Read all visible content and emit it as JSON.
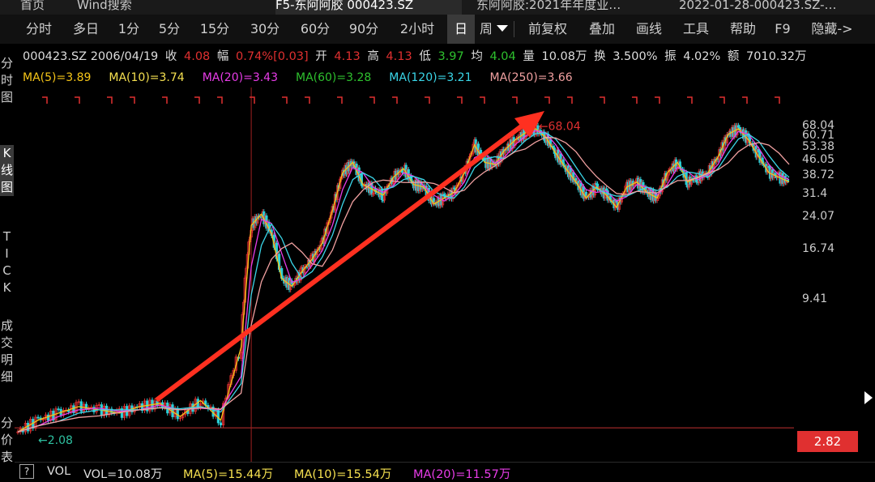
{
  "top_tabs": [
    {
      "label": "首页",
      "active": false
    },
    {
      "label": "Wind搜索",
      "active": false
    },
    {
      "label": "F5-东阿阿胶 000423.SZ",
      "active": true
    },
    {
      "label": "东阿阿胶:2021年年度业…",
      "active": false
    },
    {
      "label": "2022-01-28-000423.SZ-…",
      "active": false
    }
  ],
  "periods": [
    "分时",
    "多日",
    "1分",
    "5分",
    "15分",
    "30分",
    "60分",
    "90分",
    "2小时",
    "日",
    "周"
  ],
  "active_period": "日",
  "tools": [
    "前复权",
    "叠加",
    "画线",
    "工具",
    "帮助",
    "F9",
    "隐藏->"
  ],
  "left_rail": [
    {
      "label": "分时图",
      "active": false
    },
    {
      "label": "K线图",
      "active": true
    },
    {
      "label": "TICK",
      "active": false
    },
    {
      "label": "成交明细",
      "active": false
    },
    {
      "label": "分价表",
      "active": false
    }
  ],
  "quote": {
    "code_date": "000423.SZ 2006/04/19",
    "close_label": "收",
    "close": "4.08",
    "amp_label": "幅",
    "amp": "0.74%[0.03]",
    "open_label": "开",
    "open": "4.13",
    "high_label": "高",
    "high": "4.13",
    "low_label": "低",
    "low": "3.97",
    "avg_label": "均",
    "avg": "4.04",
    "vol_label": "量",
    "vol": "10.08万",
    "turn_label": "换",
    "turn": "3.500%",
    "swing_label": "振",
    "swing": "4.02%",
    "amount_label": "额",
    "amount": "7010.32万"
  },
  "ma_labels": [
    {
      "text": "MA(5)=3.89",
      "color": "#f5c518"
    },
    {
      "text": "MA(10)=3.74",
      "color": "#f5e050"
    },
    {
      "text": "MA(20)=3.43",
      "color": "#e83ce8"
    },
    {
      "text": "MA(60)=3.28",
      "color": "#2ec02e"
    },
    {
      "text": "MA(120)=3.21",
      "color": "#3ad6e8"
    },
    {
      "text": "MA(250)=3.66",
      "color": "#f0a0a0"
    }
  ],
  "volume": {
    "help": "?",
    "title": "VOL",
    "items": [
      {
        "text": "VOL=10.08万",
        "color": "#dddddd"
      },
      {
        "text": "MA(5)=15.44万",
        "color": "#f5e050"
      },
      {
        "text": "MA(10)=15.54万",
        "color": "#f5e050"
      },
      {
        "text": "MA(20)=11.57万",
        "color": "#e83ce8"
      }
    ]
  },
  "chart_data": {
    "type": "candlestick",
    "scale": "log",
    "y_ticks": [
      68.04,
      60.71,
      53.38,
      46.05,
      38.72,
      31.4,
      24.07,
      16.74,
      9.41
    ],
    "ylim": [
      1.9,
      80
    ],
    "high_annotation": "68.04",
    "low_annotation": "2.08",
    "last_price": "2.82",
    "trend_arrow": true,
    "x": [
      0,
      10,
      20,
      30,
      40,
      50,
      60,
      70,
      80,
      90,
      100,
      110,
      115,
      120,
      125,
      130,
      135,
      140,
      145,
      150,
      155,
      160,
      165,
      170,
      175,
      180,
      185,
      190,
      195,
      200,
      205,
      210,
      215,
      220,
      225,
      230,
      235,
      240,
      245,
      250,
      255,
      260,
      265,
      270,
      275,
      280,
      285,
      290,
      295,
      300,
      305,
      310,
      315,
      320,
      325,
      330,
      335,
      340,
      345,
      350,
      355,
      360,
      365,
      370,
      375,
      380
    ],
    "close": [
      2.1,
      2.4,
      2.6,
      2.8,
      2.7,
      2.6,
      2.8,
      2.9,
      2.5,
      3.0,
      2.4,
      5.5,
      22,
      25,
      20,
      12,
      11,
      13,
      15,
      18,
      26,
      40,
      45,
      35,
      33,
      31,
      38,
      42,
      35,
      34,
      28,
      30,
      32,
      40,
      55,
      45,
      44,
      52,
      58,
      63,
      66,
      60,
      50,
      42,
      36,
      30,
      34,
      31,
      27,
      34,
      36,
      32,
      30,
      40,
      45,
      36,
      38,
      40,
      48,
      62,
      66,
      58,
      48,
      40,
      38,
      36
    ],
    "ma_colors": {
      "ma5": "#f5c518",
      "ma10": "#e83ce8",
      "ma20": "#3ad6e8",
      "ma60": "#f0a0a0"
    },
    "up_color": "#e03030",
    "down_color": "#2ad0d8"
  }
}
